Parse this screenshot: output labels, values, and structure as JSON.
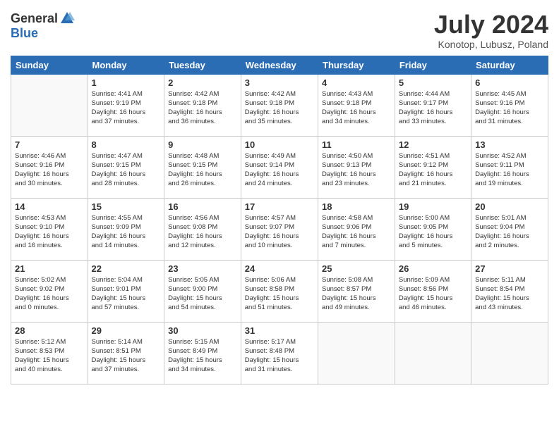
{
  "logo": {
    "general": "General",
    "blue": "Blue"
  },
  "title": {
    "month_year": "July 2024",
    "location": "Konotop, Lubusz, Poland"
  },
  "calendar": {
    "headers": [
      "Sunday",
      "Monday",
      "Tuesday",
      "Wednesday",
      "Thursday",
      "Friday",
      "Saturday"
    ],
    "weeks": [
      [
        {
          "day": "",
          "info": ""
        },
        {
          "day": "1",
          "info": "Sunrise: 4:41 AM\nSunset: 9:19 PM\nDaylight: 16 hours\nand 37 minutes."
        },
        {
          "day": "2",
          "info": "Sunrise: 4:42 AM\nSunset: 9:18 PM\nDaylight: 16 hours\nand 36 minutes."
        },
        {
          "day": "3",
          "info": "Sunrise: 4:42 AM\nSunset: 9:18 PM\nDaylight: 16 hours\nand 35 minutes."
        },
        {
          "day": "4",
          "info": "Sunrise: 4:43 AM\nSunset: 9:18 PM\nDaylight: 16 hours\nand 34 minutes."
        },
        {
          "day": "5",
          "info": "Sunrise: 4:44 AM\nSunset: 9:17 PM\nDaylight: 16 hours\nand 33 minutes."
        },
        {
          "day": "6",
          "info": "Sunrise: 4:45 AM\nSunset: 9:16 PM\nDaylight: 16 hours\nand 31 minutes."
        }
      ],
      [
        {
          "day": "7",
          "info": "Sunrise: 4:46 AM\nSunset: 9:16 PM\nDaylight: 16 hours\nand 30 minutes."
        },
        {
          "day": "8",
          "info": "Sunrise: 4:47 AM\nSunset: 9:15 PM\nDaylight: 16 hours\nand 28 minutes."
        },
        {
          "day": "9",
          "info": "Sunrise: 4:48 AM\nSunset: 9:15 PM\nDaylight: 16 hours\nand 26 minutes."
        },
        {
          "day": "10",
          "info": "Sunrise: 4:49 AM\nSunset: 9:14 PM\nDaylight: 16 hours\nand 24 minutes."
        },
        {
          "day": "11",
          "info": "Sunrise: 4:50 AM\nSunset: 9:13 PM\nDaylight: 16 hours\nand 23 minutes."
        },
        {
          "day": "12",
          "info": "Sunrise: 4:51 AM\nSunset: 9:12 PM\nDaylight: 16 hours\nand 21 minutes."
        },
        {
          "day": "13",
          "info": "Sunrise: 4:52 AM\nSunset: 9:11 PM\nDaylight: 16 hours\nand 19 minutes."
        }
      ],
      [
        {
          "day": "14",
          "info": "Sunrise: 4:53 AM\nSunset: 9:10 PM\nDaylight: 16 hours\nand 16 minutes."
        },
        {
          "day": "15",
          "info": "Sunrise: 4:55 AM\nSunset: 9:09 PM\nDaylight: 16 hours\nand 14 minutes."
        },
        {
          "day": "16",
          "info": "Sunrise: 4:56 AM\nSunset: 9:08 PM\nDaylight: 16 hours\nand 12 minutes."
        },
        {
          "day": "17",
          "info": "Sunrise: 4:57 AM\nSunset: 9:07 PM\nDaylight: 16 hours\nand 10 minutes."
        },
        {
          "day": "18",
          "info": "Sunrise: 4:58 AM\nSunset: 9:06 PM\nDaylight: 16 hours\nand 7 minutes."
        },
        {
          "day": "19",
          "info": "Sunrise: 5:00 AM\nSunset: 9:05 PM\nDaylight: 16 hours\nand 5 minutes."
        },
        {
          "day": "20",
          "info": "Sunrise: 5:01 AM\nSunset: 9:04 PM\nDaylight: 16 hours\nand 2 minutes."
        }
      ],
      [
        {
          "day": "21",
          "info": "Sunrise: 5:02 AM\nSunset: 9:02 PM\nDaylight: 16 hours\nand 0 minutes."
        },
        {
          "day": "22",
          "info": "Sunrise: 5:04 AM\nSunset: 9:01 PM\nDaylight: 15 hours\nand 57 minutes."
        },
        {
          "day": "23",
          "info": "Sunrise: 5:05 AM\nSunset: 9:00 PM\nDaylight: 15 hours\nand 54 minutes."
        },
        {
          "day": "24",
          "info": "Sunrise: 5:06 AM\nSunset: 8:58 PM\nDaylight: 15 hours\nand 51 minutes."
        },
        {
          "day": "25",
          "info": "Sunrise: 5:08 AM\nSunset: 8:57 PM\nDaylight: 15 hours\nand 49 minutes."
        },
        {
          "day": "26",
          "info": "Sunrise: 5:09 AM\nSunset: 8:56 PM\nDaylight: 15 hours\nand 46 minutes."
        },
        {
          "day": "27",
          "info": "Sunrise: 5:11 AM\nSunset: 8:54 PM\nDaylight: 15 hours\nand 43 minutes."
        }
      ],
      [
        {
          "day": "28",
          "info": "Sunrise: 5:12 AM\nSunset: 8:53 PM\nDaylight: 15 hours\nand 40 minutes."
        },
        {
          "day": "29",
          "info": "Sunrise: 5:14 AM\nSunset: 8:51 PM\nDaylight: 15 hours\nand 37 minutes."
        },
        {
          "day": "30",
          "info": "Sunrise: 5:15 AM\nSunset: 8:49 PM\nDaylight: 15 hours\nand 34 minutes."
        },
        {
          "day": "31",
          "info": "Sunrise: 5:17 AM\nSunset: 8:48 PM\nDaylight: 15 hours\nand 31 minutes."
        },
        {
          "day": "",
          "info": ""
        },
        {
          "day": "",
          "info": ""
        },
        {
          "day": "",
          "info": ""
        }
      ]
    ]
  }
}
